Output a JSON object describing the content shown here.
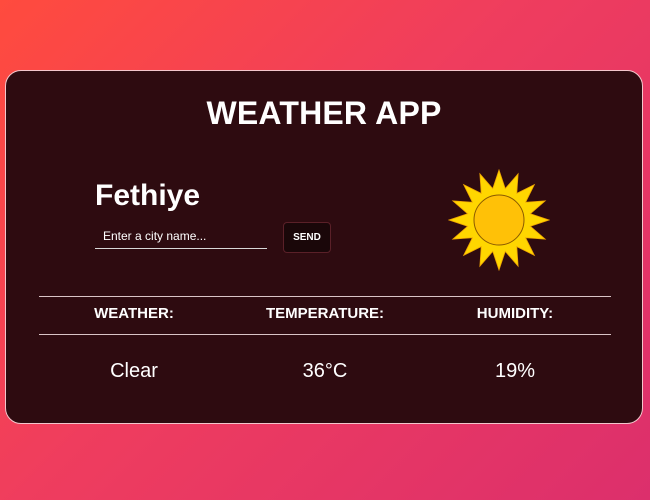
{
  "app": {
    "title": "WEATHER APP"
  },
  "location": {
    "city": "Fethiye"
  },
  "search": {
    "placeholder": "Enter a city name...",
    "value": "",
    "button_label": "SEND"
  },
  "current_icon": "sun-icon",
  "stats": {
    "headers": [
      "WEATHER:",
      "TEMPERATURE:",
      "HUMIDITY:"
    ],
    "values": [
      "Clear",
      "36°C",
      "19%"
    ]
  },
  "colors": {
    "background_gradient_start": "#ff4b3e",
    "background_gradient_end": "#dc2f6c",
    "card_background": "#2e0b10",
    "sun_core": "#ffc107",
    "sun_rays": "#ffd600"
  }
}
